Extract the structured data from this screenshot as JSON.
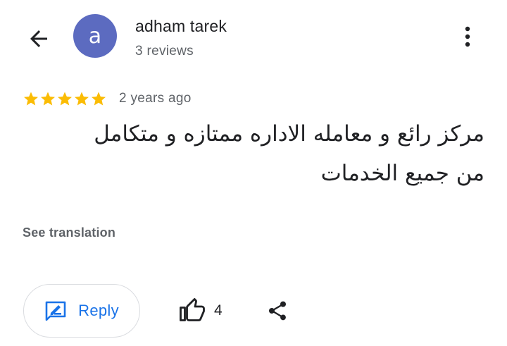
{
  "header": {
    "back_icon": "arrow-back-icon",
    "avatar_letter": "a",
    "avatar_color": "#5c6bc0",
    "user_name": "adham tarek",
    "review_count": "3 reviews",
    "more_icon": "more-vert-icon"
  },
  "review": {
    "rating": 5,
    "max_rating": 5,
    "star_color": "#fbbc04",
    "time_ago": "2 years ago",
    "text_line1": "مركز رائع و معامله الاداره ممتازه و متكامل",
    "text_line2": "من جميع الخدمات",
    "see_translation": "See translation"
  },
  "actions": {
    "reply_label": "Reply",
    "reply_icon": "reply-icon",
    "accent_color": "#1a73e8",
    "like_icon": "thumb-up-icon",
    "like_count": "4",
    "share_icon": "share-icon"
  }
}
